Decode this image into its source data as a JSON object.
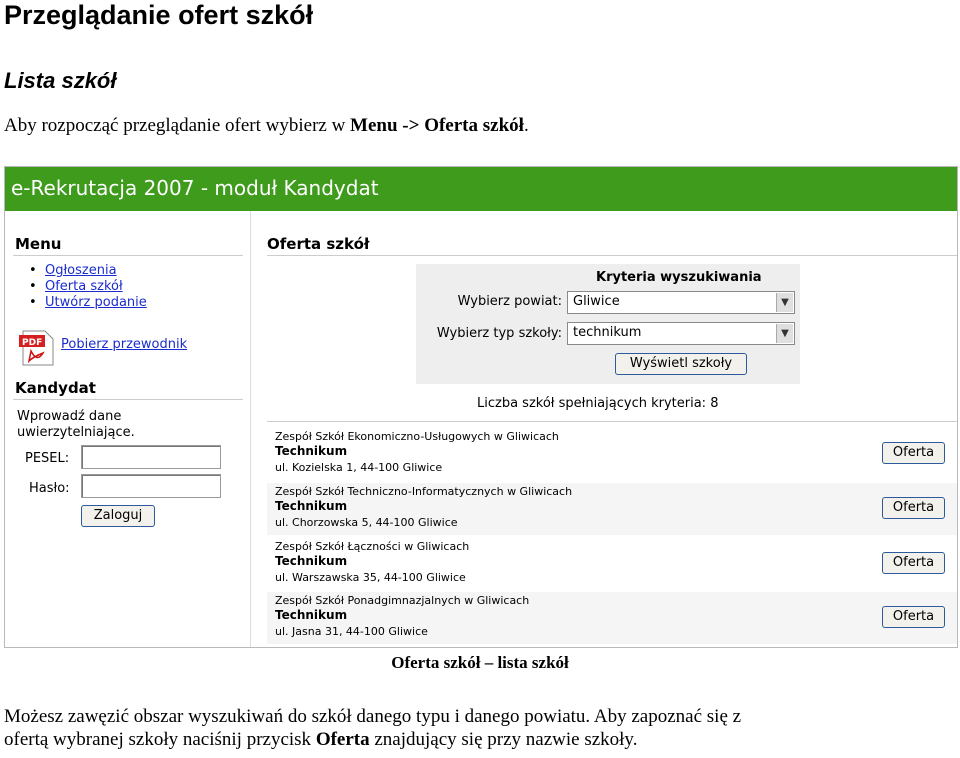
{
  "doc": {
    "title": "Przeglądanie ofert szkół",
    "subtitle": "Lista szkół",
    "intro_prefix": "Aby rozpocząć przeglądanie ofert wybierz w ",
    "intro_bold": "Menu -> Oferta szkół",
    "intro_suffix": ".",
    "caption": "Oferta szkół – lista szkół",
    "body_line1": "Możesz zawęzić obszar wyszukiwań do szkół danego typu i danego powiatu. Aby zapoznać się z",
    "body_line2_prefix": "ofertą wybranej szkoły naciśnij przycisk ",
    "body_line2_bold": "Oferta",
    "body_line2_suffix": " znajdujący się przy nazwie szkoły."
  },
  "app": {
    "header_title": "e-Rekrutacja 2007 - moduł Kandydat",
    "menu": {
      "heading": "Menu",
      "items": [
        "Ogłoszenia",
        "Oferta szkół",
        "Utwórz podanie"
      ],
      "guide": "Pobierz przewodnik",
      "pdf_icon_text": "PDF"
    },
    "candidate": {
      "heading": "Kandydat",
      "info": "Wprowadź dane uwierzytelniające.",
      "pesel_label": "PESEL:",
      "password_label": "Hasło:",
      "login_button": "Zaloguj"
    },
    "main": {
      "heading": "Oferta szkół",
      "criteria_title": "Kryteria wyszukiwania",
      "district_label": "Wybierz powiat:",
      "district_value": "Gliwice",
      "type_label": "Wybierz typ szkoły:",
      "type_value": "technikum",
      "show_button": "Wyświetl szkoły",
      "count_text": "Liczba szkół spełniających kryteria: 8",
      "offer_button": "Oferta",
      "schools": [
        {
          "name": "Zespół Szkół Ekonomiczno-Usługowych w Gliwicach",
          "type": "Technikum",
          "address": "ul. Kozielska 1, 44-100 Gliwice"
        },
        {
          "name": "Zespół Szkół Techniczno-Informatycznych w Gliwicach",
          "type": "Technikum",
          "address": "ul. Chorzowska 5, 44-100 Gliwice"
        },
        {
          "name": "Zespół Szkół Łączności w Gliwicach",
          "type": "Technikum",
          "address": "ul. Warszawska 35, 44-100 Gliwice"
        },
        {
          "name": "Zespół Szkół Ponadgimnazjalnych w Gliwicach",
          "type": "Technikum",
          "address": "ul. Jasna 31, 44-100 Gliwice"
        }
      ]
    }
  }
}
